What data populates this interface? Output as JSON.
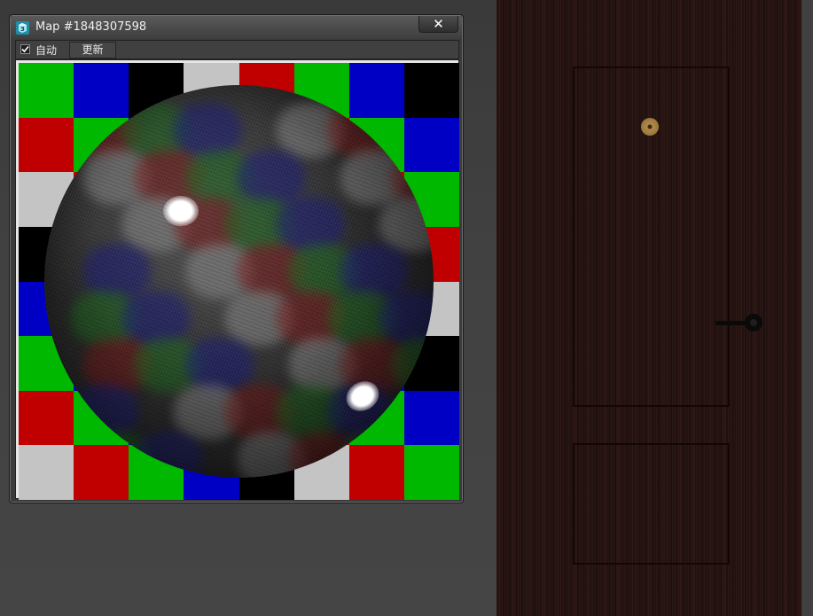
{
  "window": {
    "title": "Map #1848307598",
    "close_symbol": "✕",
    "app_icon": "3ds-max-icon"
  },
  "toolbar": {
    "auto_label": "自动",
    "auto_checked": true,
    "update_label": "更新"
  },
  "preview": {
    "checker_colors": {
      "G": "#00b800",
      "B": "#0000c4",
      "K": "#000000",
      "W": "#c4c4c4",
      "R": "#c00000"
    },
    "checker_rows": [
      [
        "G",
        "B",
        "K",
        "W",
        "R",
        "G",
        "B",
        "K"
      ],
      [
        "R",
        "G",
        "B",
        "K",
        "W",
        "R",
        "G",
        "B"
      ],
      [
        "W",
        "R",
        "G",
        "B",
        "K",
        "W",
        "R",
        "G"
      ],
      [
        "K",
        "W",
        "R",
        "G",
        "B",
        "K",
        "W",
        "R"
      ],
      [
        "B",
        "K",
        "W",
        "R",
        "G",
        "B",
        "K",
        "W"
      ],
      [
        "G",
        "B",
        "K",
        "W",
        "R",
        "G",
        "B",
        "K"
      ],
      [
        "R",
        "G",
        "B",
        "K",
        "W",
        "R",
        "G",
        "B"
      ],
      [
        "W",
        "R",
        "G",
        "B",
        "K",
        "W",
        "R",
        "G"
      ]
    ]
  },
  "background": {
    "door_color": "#241210",
    "viewport_color": "#444444"
  }
}
